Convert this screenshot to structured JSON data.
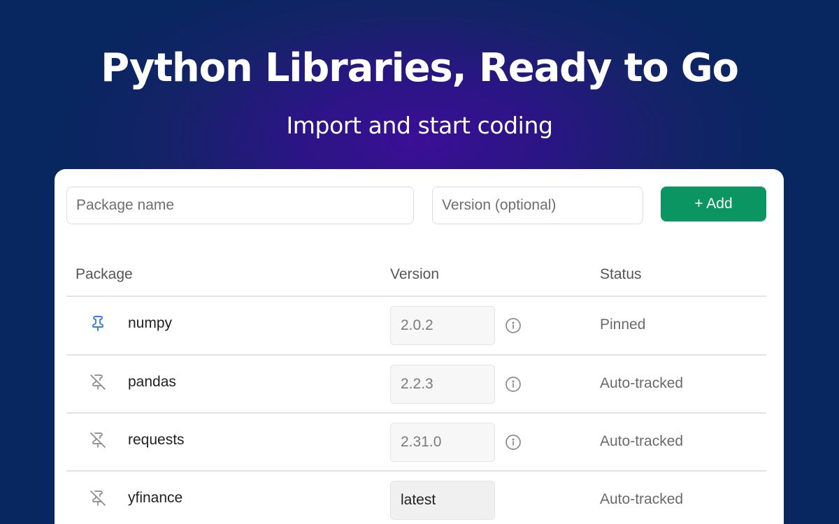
{
  "hero": {
    "title": "Python Libraries, Ready to Go",
    "subtitle": "Import and start coding"
  },
  "form": {
    "package_placeholder": "Package name",
    "version_placeholder": "Version (optional)",
    "add_label": "+ Add"
  },
  "table": {
    "headers": {
      "package": "Package",
      "version": "Version",
      "status": "Status"
    },
    "rows": [
      {
        "name": "numpy",
        "version": "2.0.2",
        "status": "Pinned",
        "pinned": true
      },
      {
        "name": "pandas",
        "version": "2.2.3",
        "status": "Auto-tracked",
        "pinned": false
      },
      {
        "name": "requests",
        "version": "2.31.0",
        "status": "Auto-tracked",
        "pinned": false
      },
      {
        "name": "yfinance",
        "version": "latest",
        "status": "Auto-tracked",
        "pinned": false
      }
    ]
  },
  "colors": {
    "accent": "#0a9563",
    "pin_active": "#3b7dde",
    "pin_inactive": "#8a8a8a",
    "background": "#082660"
  },
  "icons": {
    "pinned": "pin-icon",
    "unpinned": "pin-off-icon",
    "info": "info-icon"
  }
}
